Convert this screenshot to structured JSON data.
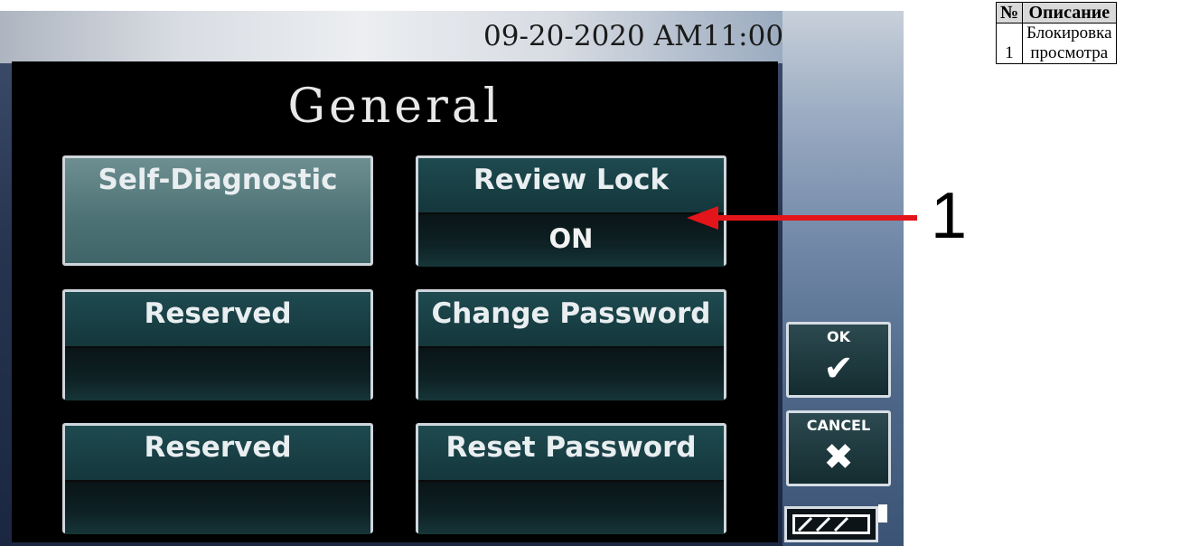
{
  "screen": {
    "datetime": "09-20-2020 AM11:00",
    "title": "General",
    "tiles": [
      {
        "label": "Self-Diagnostic",
        "value": ""
      },
      {
        "label": "Review Lock",
        "value": "ON"
      },
      {
        "label": "Reserved",
        "value": ""
      },
      {
        "label": "Change Password",
        "value": ""
      },
      {
        "label": "Reserved",
        "value": ""
      },
      {
        "label": "Reset Password",
        "value": ""
      }
    ],
    "ok_label": "OK",
    "cancel_label": "CANCEL",
    "ok_icon": "checkmark-icon",
    "cancel_icon": "x-icon",
    "battery_icon": "battery-icon"
  },
  "annotation": {
    "callout_number": "1",
    "arrow_color": "#e3151a"
  },
  "legend": {
    "headers": [
      "№",
      "Описание"
    ],
    "rows": [
      {
        "num": "1",
        "desc_line1": "Блокировка",
        "desc_line2": "просмотра"
      }
    ]
  }
}
